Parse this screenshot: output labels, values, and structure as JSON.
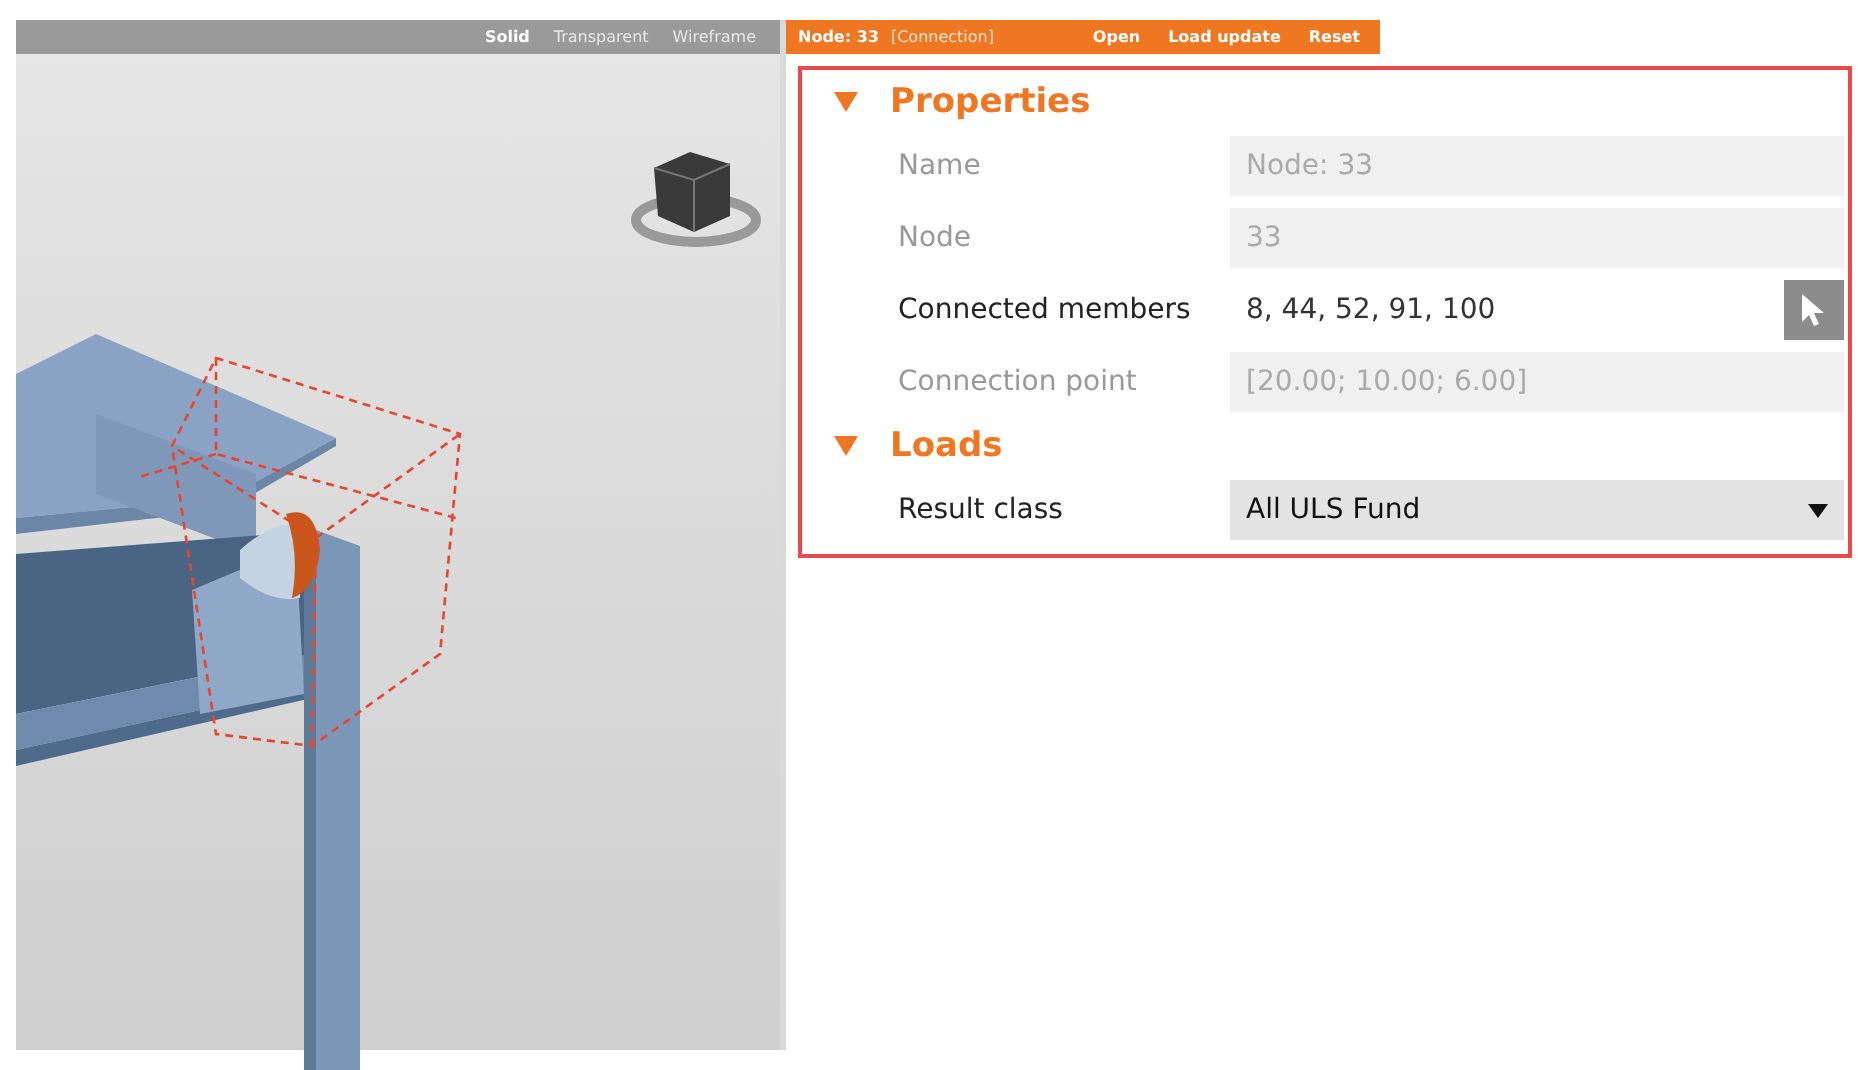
{
  "viewport": {
    "modes": [
      {
        "label": "Solid",
        "selected": true
      },
      {
        "label": "Transparent",
        "selected": false
      },
      {
        "label": "Wireframe",
        "selected": false
      }
    ]
  },
  "header": {
    "title": "Node: 33",
    "subtitle": "[Connection]",
    "actions": [
      "Open",
      "Load update",
      "Reset"
    ]
  },
  "sections": [
    {
      "title": "Properties",
      "expanded": true,
      "rows": [
        {
          "label": "Name",
          "value": "Node: 33",
          "kind": "text",
          "disabled": true
        },
        {
          "label": "Node",
          "value": "33",
          "kind": "text",
          "disabled": true
        },
        {
          "label": "Connected members",
          "value": "8, 44, 52, 91, 100",
          "kind": "picker",
          "disabled": false
        },
        {
          "label": "Connection point",
          "value": "[20.00; 10.00; 6.00]",
          "kind": "text",
          "disabled": true
        }
      ]
    },
    {
      "title": "Loads",
      "expanded": true,
      "rows": [
        {
          "label": "Result class",
          "value": "All ULS Fund",
          "kind": "dropdown",
          "disabled": false
        }
      ]
    }
  ]
}
